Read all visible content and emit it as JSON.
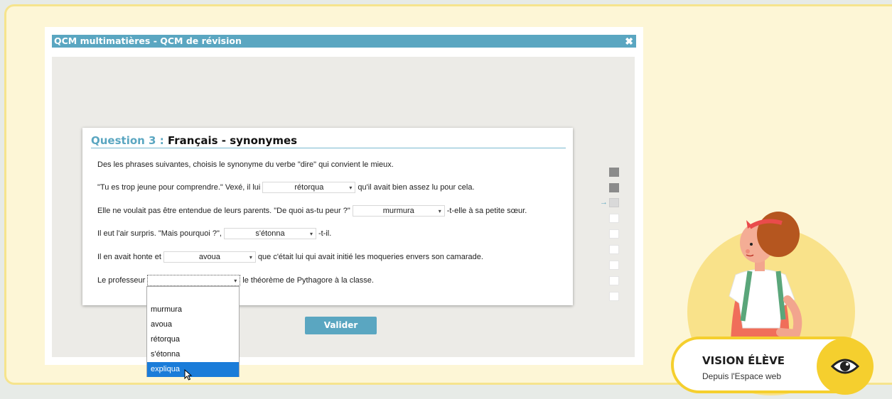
{
  "window": {
    "title": "QCM multimatières - QCM de révision",
    "close_glyph": "✖"
  },
  "question": {
    "number_label": "Question 3 :",
    "subject": "Français - synonymes",
    "instruction": "Des les phrases suivantes, choisis le synonyme du verbe \"dire\" qui convient le mieux.",
    "lines": [
      {
        "before": "\"Tu es trop jeune pour comprendre.\" Vexé, il lui",
        "value": "rétorqua",
        "after": "qu'il avait bien assez lu pour cela."
      },
      {
        "before": "Elle ne voulait pas être entendue de leurs parents. \"De quoi as-tu peur ?\"",
        "value": "murmura",
        "after": "-t-elle à sa petite sœur."
      },
      {
        "before": "Il eut l'air surpris. \"Mais pourquoi ?\",",
        "value": "s'étonna",
        "after": "-t-il."
      },
      {
        "before": "Il en avait honte et",
        "value": "avoua",
        "after": "que c'était lui qui avait initié les moqueries envers son camarade."
      },
      {
        "before": "Le professeur",
        "value": "",
        "after": "le théorème de Pythagore à la classe."
      }
    ],
    "dropdown_arrow": "▾"
  },
  "dropdown": {
    "options": [
      "",
      "murmura",
      "avoua",
      "rétorqua",
      "s'étonna",
      "expliqua"
    ],
    "highlighted_index": 5
  },
  "submit_label": "Valider",
  "progress": {
    "arrow": "→",
    "states": [
      "done",
      "done",
      "current",
      "todo",
      "todo",
      "todo",
      "todo",
      "todo",
      "todo"
    ]
  },
  "badge": {
    "title": "VISION ÉLÈVE",
    "subtitle": "Depuis l'Espace web"
  },
  "colors": {
    "accent": "#5aa6c1",
    "highlight": "#1a7cd9",
    "badge_yellow": "#f5cf2e",
    "frame_bg": "#fdf6d6"
  }
}
